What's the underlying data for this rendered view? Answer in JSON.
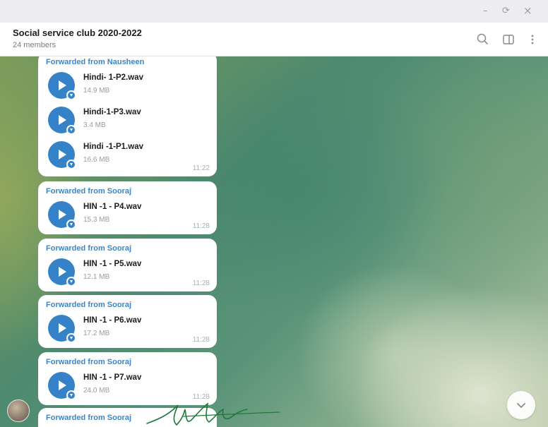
{
  "window": {
    "controls": {
      "minimize": "–",
      "maximize": "⟳",
      "close": "×"
    }
  },
  "header": {
    "title": "Social service club 2020-2022",
    "subtitle": "24 members",
    "icons": [
      "search-icon",
      "sidebar-toggle-icon",
      "more-vert-icon"
    ]
  },
  "messages": [
    {
      "forwarded_from": "Forwarded from Nausheen",
      "files": [
        {
          "name": "Hindi- 1-P2.wav",
          "size": "14.9 MB"
        },
        {
          "name": "Hindi-1-P3.wav",
          "size": "3.4 MB"
        },
        {
          "name": "Hindi -1-P1.wav",
          "size": "16.6 MB"
        }
      ],
      "time": "11:22"
    },
    {
      "forwarded_from": "Forwarded from Sooraj",
      "files": [
        {
          "name": "HIN -1 - P4.wav",
          "size": "15.3 MB"
        }
      ],
      "time": "11:28"
    },
    {
      "forwarded_from": "Forwarded from Sooraj",
      "files": [
        {
          "name": "HIN -1 - P5.wav",
          "size": "12.1 MB"
        }
      ],
      "time": "11:28"
    },
    {
      "forwarded_from": "Forwarded from Sooraj",
      "files": [
        {
          "name": "HIN -1 - P6.wav",
          "size": "17.2 MB"
        }
      ],
      "time": "11:28"
    },
    {
      "forwarded_from": "Forwarded from Sooraj",
      "files": [
        {
          "name": "HIN -1 - P7.wav",
          "size": "24.0 MB"
        }
      ],
      "time": "11:28"
    },
    {
      "forwarded_from": "Forwarded from Sooraj",
      "files": [],
      "time": ""
    }
  ],
  "colors": {
    "accent": "#3582c9",
    "forward_label": "#3a86c8",
    "bubble": "#ffffff"
  }
}
